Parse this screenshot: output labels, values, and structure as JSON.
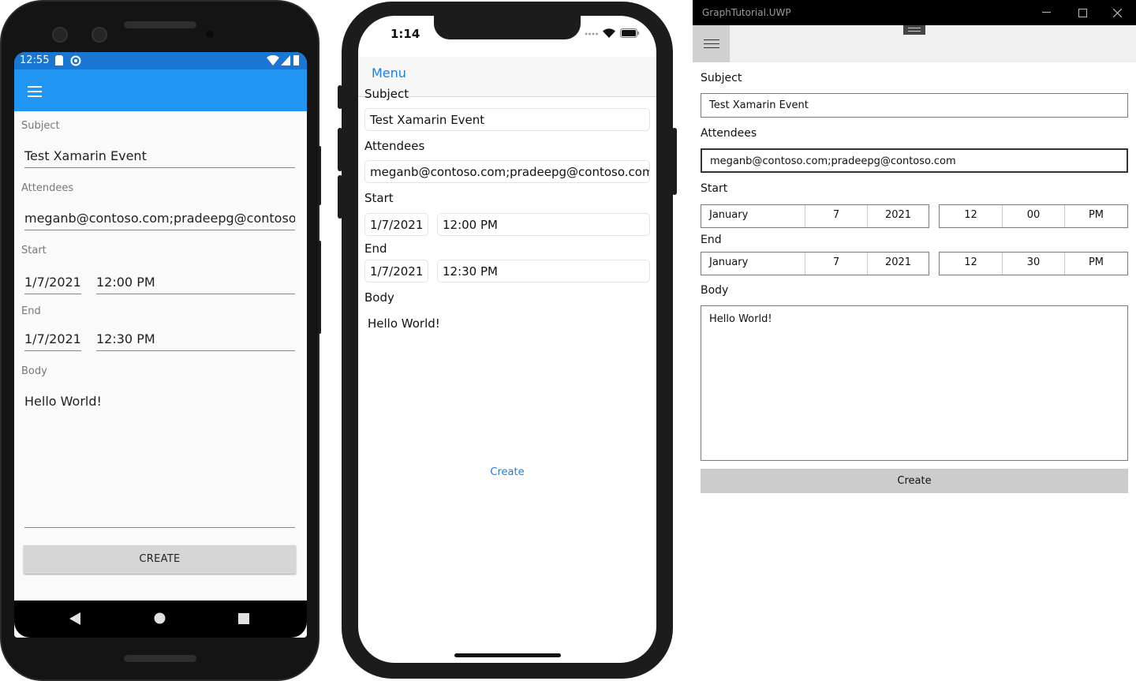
{
  "android": {
    "status": {
      "time": "12:55"
    },
    "form": {
      "subject_label": "Subject",
      "subject_value": "Test Xamarin Event",
      "attendees_label": "Attendees",
      "attendees_value": "meganb@contoso.com;pradeepg@contoso.com",
      "start_label": "Start",
      "start_date": "1/7/2021",
      "start_time": "12:00 PM",
      "end_label": "End",
      "end_date": "1/7/2021",
      "end_time": "12:30 PM",
      "body_label": "Body",
      "body_value": "Hello World!",
      "create_label": "CREATE"
    },
    "colors": {
      "status": "#1976d2",
      "toolbar": "#2196f3"
    }
  },
  "ios": {
    "status": {
      "time": "1:14"
    },
    "nav": {
      "menu_label": "Menu"
    },
    "form": {
      "subject_label": "Subject",
      "subject_value": "Test Xamarin Event",
      "attendees_label": "Attendees",
      "attendees_value": "meganb@contoso.com;pradeepg@contoso.com",
      "start_label": "Start",
      "start_date": "1/7/2021",
      "start_time": "12:00 PM",
      "end_label": "End",
      "end_date": "1/7/2021",
      "end_time": "12:30 PM",
      "body_label": "Body",
      "body_value": "Hello World!",
      "create_label": "Create"
    },
    "colors": {
      "accent": "#1a7fe8"
    }
  },
  "uwp": {
    "window_title": "GraphTutorial.UWP",
    "form": {
      "subject_label": "Subject",
      "subject_value": "Test Xamarin Event",
      "attendees_label": "Attendees",
      "attendees_value": "meganb@contoso.com;pradeepg@contoso.com",
      "start_label": "Start",
      "start_month": "January",
      "start_day": "7",
      "start_year": "2021",
      "start_hour": "12",
      "start_minute": "00",
      "start_period": "PM",
      "end_label": "End",
      "end_month": "January",
      "end_day": "7",
      "end_year": "2021",
      "end_hour": "12",
      "end_minute": "30",
      "end_period": "PM",
      "body_label": "Body",
      "body_value": "Hello World!",
      "create_label": "Create"
    }
  }
}
